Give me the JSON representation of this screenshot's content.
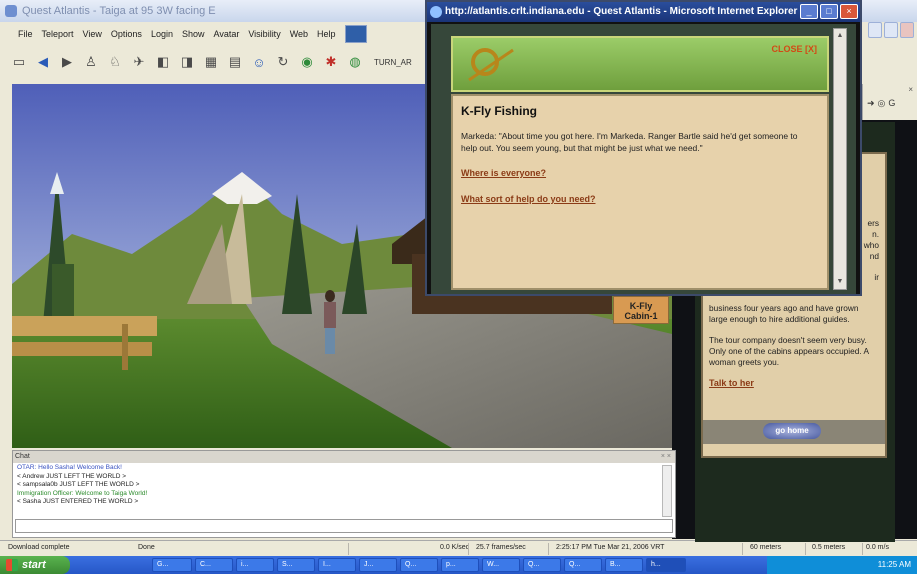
{
  "app": {
    "title": "Quest Atlantis - Taiga at 95 3W facing E",
    "menu": [
      "File",
      "Teleport",
      "View",
      "Options",
      "Login",
      "Show",
      "Avatar",
      "Visibility",
      "Web",
      "Help"
    ],
    "toolbar_text": "TURN_AR"
  },
  "scene": {
    "cabin_sign": "Cabin-1",
    "cabin_sign_top": "K-Fly"
  },
  "chat": {
    "header": "Chat",
    "lines": [
      {
        "text": "OTAR:         Hello Sasha! Welcome Back!",
        "color": "blue"
      },
      {
        "text": "< Andrew JUST LEFT THE WORLD >",
        "color": "black"
      },
      {
        "text": "< sampsala0b JUST LEFT THE WORLD >",
        "color": "black"
      },
      {
        "text": "Immigration Officer:    Welcome to Taiga World!",
        "color": "green"
      },
      {
        "text": "< Sasha JUST ENTERED THE WORLD >",
        "color": "black"
      }
    ]
  },
  "status": {
    "left": "Download complete",
    "done": "Done",
    "rate": "0.0 K/sec",
    "fps": "25.7 frames/sec",
    "clock": "2:25:17 PM Tue Mar 21, 2006 VRT",
    "dist1": "60 meters",
    "dist2": "0.5 meters",
    "speed": "0.0 m/s"
  },
  "taskbar": {
    "start": "start",
    "time": "11:25 AM",
    "tasks": [
      "G...",
      "C...",
      "i...",
      "S...",
      "I...",
      "J...",
      "Q...",
      "p...",
      "W...",
      "Q...",
      "Q...",
      "B...",
      "h..."
    ]
  },
  "ie": {
    "title": "http://atlantis.crlt.indiana.edu - Quest Atlantis - Microsoft Internet Explorer",
    "close_label": "CLOSE [X]",
    "heading": "K-Fly Fishing",
    "body": "Markeda: \"About time you got here. I'm Markeda. Ranger Bartle said he'd get someone to help out. You seem young, but that might be just what we need.\"",
    "link1": "Where is everyone?",
    "link2": "What sort of help do you need?"
  },
  "bgpanel": {
    "partial_lines": [
      "ers",
      "n.",
      "who",
      "nd",
      "ir"
    ],
    "p1": "business four years ago and have grown large enough to hire additional guides.",
    "p2": "The tour company doesn't seem very busy. Only one of the cabins appears occupied. A woman greets you.",
    "talk": "Talk to her",
    "gohome": "go home"
  },
  "colors": {
    "link": "#8b3b16",
    "parchment": "#e7d2ab",
    "ie_title": "#2a4e9c"
  }
}
